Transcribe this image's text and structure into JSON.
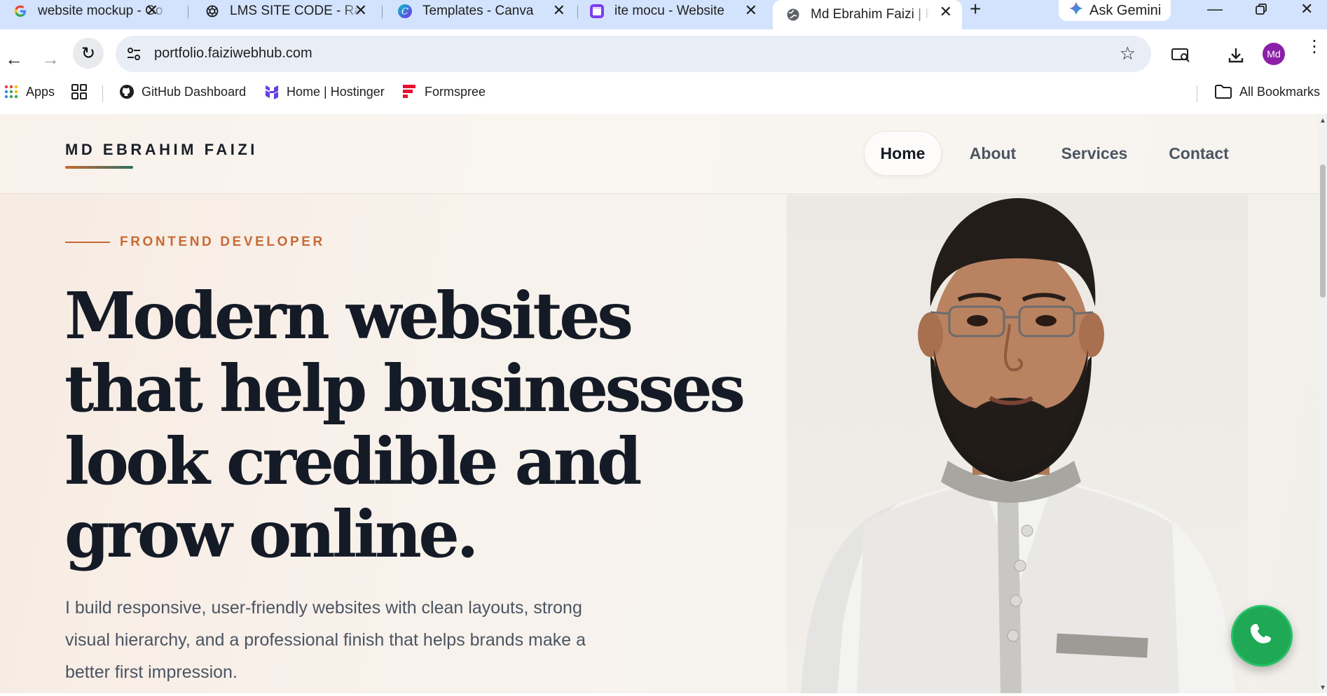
{
  "browser": {
    "tabs": [
      {
        "title": "website mockup - Go",
        "icon": "google-icon",
        "active": false
      },
      {
        "title": "LMS SITE CODE - Ran",
        "icon": "chatgpt-icon",
        "active": false
      },
      {
        "title": "Templates - Canva",
        "icon": "canva-icon",
        "active": false
      },
      {
        "title": "ite mocu - Website",
        "icon": "calendar-app-icon",
        "active": false
      },
      {
        "title": "Md Ebrahim Faizi | Fr",
        "icon": "globe-icon",
        "active": true
      }
    ],
    "new_tab_glyph": "+",
    "gemini_label": "Ask Gemini",
    "url": "portfolio.faiziwebhub.com",
    "profile_initials": "Md",
    "bookmarks": [
      {
        "label": "Apps",
        "icon": "apps-grid-icon"
      },
      {
        "label": "",
        "icon": "tab-groups-icon"
      },
      {
        "label": "GitHub Dashboard",
        "icon": "github-icon"
      },
      {
        "label": "Home | Hostinger",
        "icon": "hostinger-icon"
      },
      {
        "label": "Formspree",
        "icon": "formspree-icon"
      }
    ],
    "all_bookmarks_label": "All Bookmarks"
  },
  "site": {
    "logo": "MD EBRAHIM FAIZI",
    "nav": [
      {
        "label": "Home",
        "active": true
      },
      {
        "label": "About",
        "active": false
      },
      {
        "label": "Services",
        "active": false
      },
      {
        "label": "Contact",
        "active": false
      }
    ],
    "eyebrow": "FRONTEND DEVELOPER",
    "headline_lines": [
      "Modern websites",
      "that help businesses",
      "look credible and",
      "grow online."
    ],
    "intro_lines": [
      "I build responsive, user-friendly websites with clean layouts, strong",
      "visual hierarchy, and a professional finish that helps brands make a",
      "better first impression."
    ],
    "colors": {
      "accent": "#c86a34",
      "heading": "#151b26",
      "body_text": "#4b5563",
      "whatsapp": "#1fa855"
    }
  }
}
